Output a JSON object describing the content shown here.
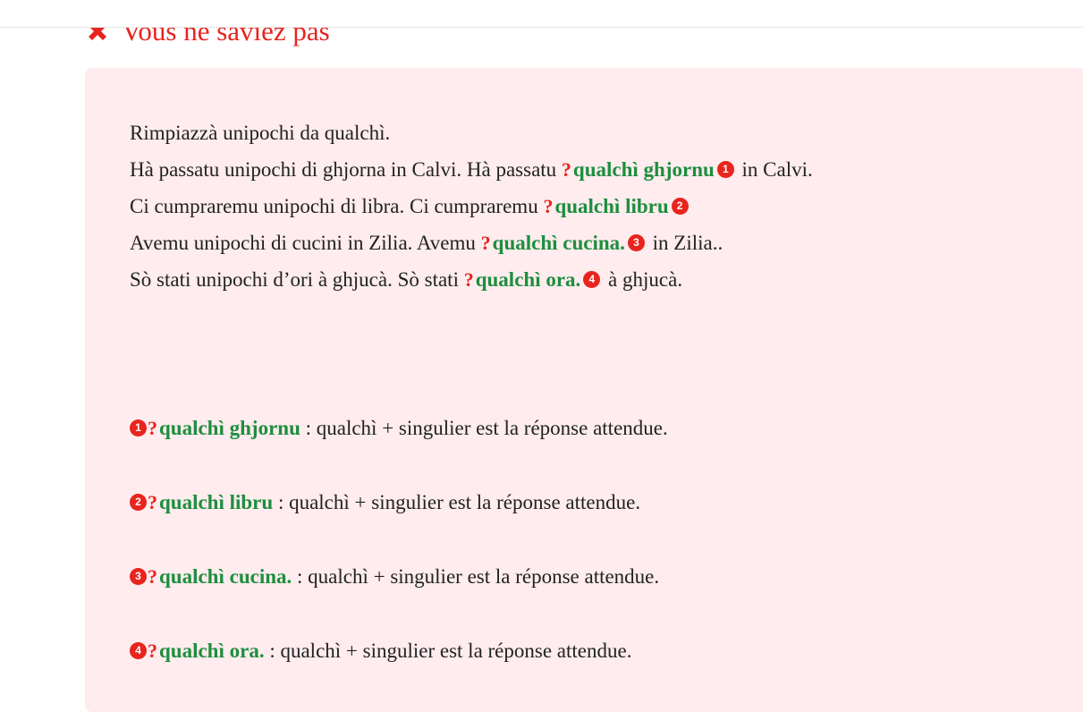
{
  "header": {
    "title": "Vous ne saviez pas",
    "icon": "x-icon",
    "color": "#e8241e"
  },
  "exercise": {
    "instruction": "Rimpiazzà unipochi da qualchì.",
    "items": [
      {
        "sentence": "Hà passatu unipochi di ghjorna in Calvi.",
        "prefix": "Hà passatu",
        "marker": "?",
        "answer": "qualchì ghjornu",
        "number": "1",
        "suffix": "in Calvi."
      },
      {
        "sentence": "Ci cumpraremu unipochi di libra.",
        "prefix": "Ci cumpraremu",
        "marker": "?",
        "answer": "qualchì libru",
        "number": "2",
        "suffix": ""
      },
      {
        "sentence": "Avemu unipochi di cucini in Zilia.",
        "prefix": "Avemu",
        "marker": "?",
        "answer": "qualchì cucina.",
        "number": "3",
        "suffix": "in Zilia.."
      },
      {
        "sentence": "Sò stati unipochi d’ori à ghjucà.",
        "prefix": "Sò stati",
        "marker": "?",
        "answer": "qualchì ora.",
        "number": "4",
        "suffix": "à ghjucà."
      }
    ]
  },
  "feedback": [
    {
      "number": "1",
      "marker": "?",
      "answer": "qualchì ghjornu",
      "explanation": ": qualchì + singulier est la réponse attendue."
    },
    {
      "number": "2",
      "marker": "?",
      "answer": "qualchì libru",
      "explanation": ": qualchì + singulier est la réponse attendue."
    },
    {
      "number": "3",
      "marker": "?",
      "answer": "qualchì cucina.",
      "explanation": ": qualchì + singulier est la réponse attendue."
    },
    {
      "number": "4",
      "marker": "?",
      "answer": "qualchì ora.",
      "explanation": ": qualchì + singulier est la réponse attendue."
    }
  ],
  "colors": {
    "panel_background": "#feecee",
    "error_red": "#e8241e",
    "answer_green": "#1e8e3e",
    "text": "#222222"
  }
}
